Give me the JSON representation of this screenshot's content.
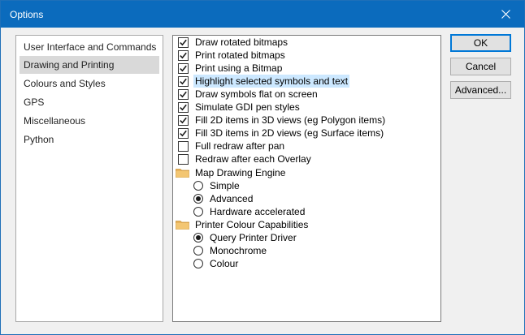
{
  "window": {
    "title": "Options"
  },
  "nav": {
    "items": [
      {
        "label": "User Interface and Commands",
        "selected": false
      },
      {
        "label": "Drawing and Printing",
        "selected": true
      },
      {
        "label": "Colours and Styles",
        "selected": false
      },
      {
        "label": "GPS",
        "selected": false
      },
      {
        "label": "Miscellaneous",
        "selected": false
      },
      {
        "label": "Python",
        "selected": false
      }
    ]
  },
  "options": {
    "checkboxes": [
      {
        "label": "Draw rotated bitmaps",
        "checked": true
      },
      {
        "label": "Print rotated bitmaps",
        "checked": true
      },
      {
        "label": "Print using a Bitmap",
        "checked": true
      },
      {
        "label": "Highlight selected symbols and text",
        "checked": true
      },
      {
        "label": "Draw symbols flat on screen",
        "checked": true
      },
      {
        "label": "Simulate GDI pen styles",
        "checked": true
      },
      {
        "label": "Fill 2D items in 3D views (eg Polygon items)",
        "checked": true
      },
      {
        "label": "Fill 3D items in 2D views (eg Surface items)",
        "checked": true
      },
      {
        "label": "Full redraw after pan",
        "checked": false
      },
      {
        "label": "Redraw after each Overlay",
        "checked": false
      }
    ],
    "groups": [
      {
        "label": "Map Drawing Engine",
        "options": [
          {
            "label": "Simple",
            "selected": false
          },
          {
            "label": "Advanced",
            "selected": true
          },
          {
            "label": "Hardware accelerated",
            "selected": false
          }
        ]
      },
      {
        "label": "Printer Colour Capabilities",
        "options": [
          {
            "label": "Query Printer Driver",
            "selected": true
          },
          {
            "label": "Monochrome",
            "selected": false
          },
          {
            "label": "Colour",
            "selected": false
          }
        ]
      }
    ]
  },
  "buttons": {
    "ok": "OK",
    "cancel": "Cancel",
    "advanced": "Advanced..."
  },
  "colors": {
    "titlebar": "#0b6bbd",
    "selection": "#d9d9d9",
    "highlight": "#cce8ff",
    "folder": "#e8b25a"
  }
}
